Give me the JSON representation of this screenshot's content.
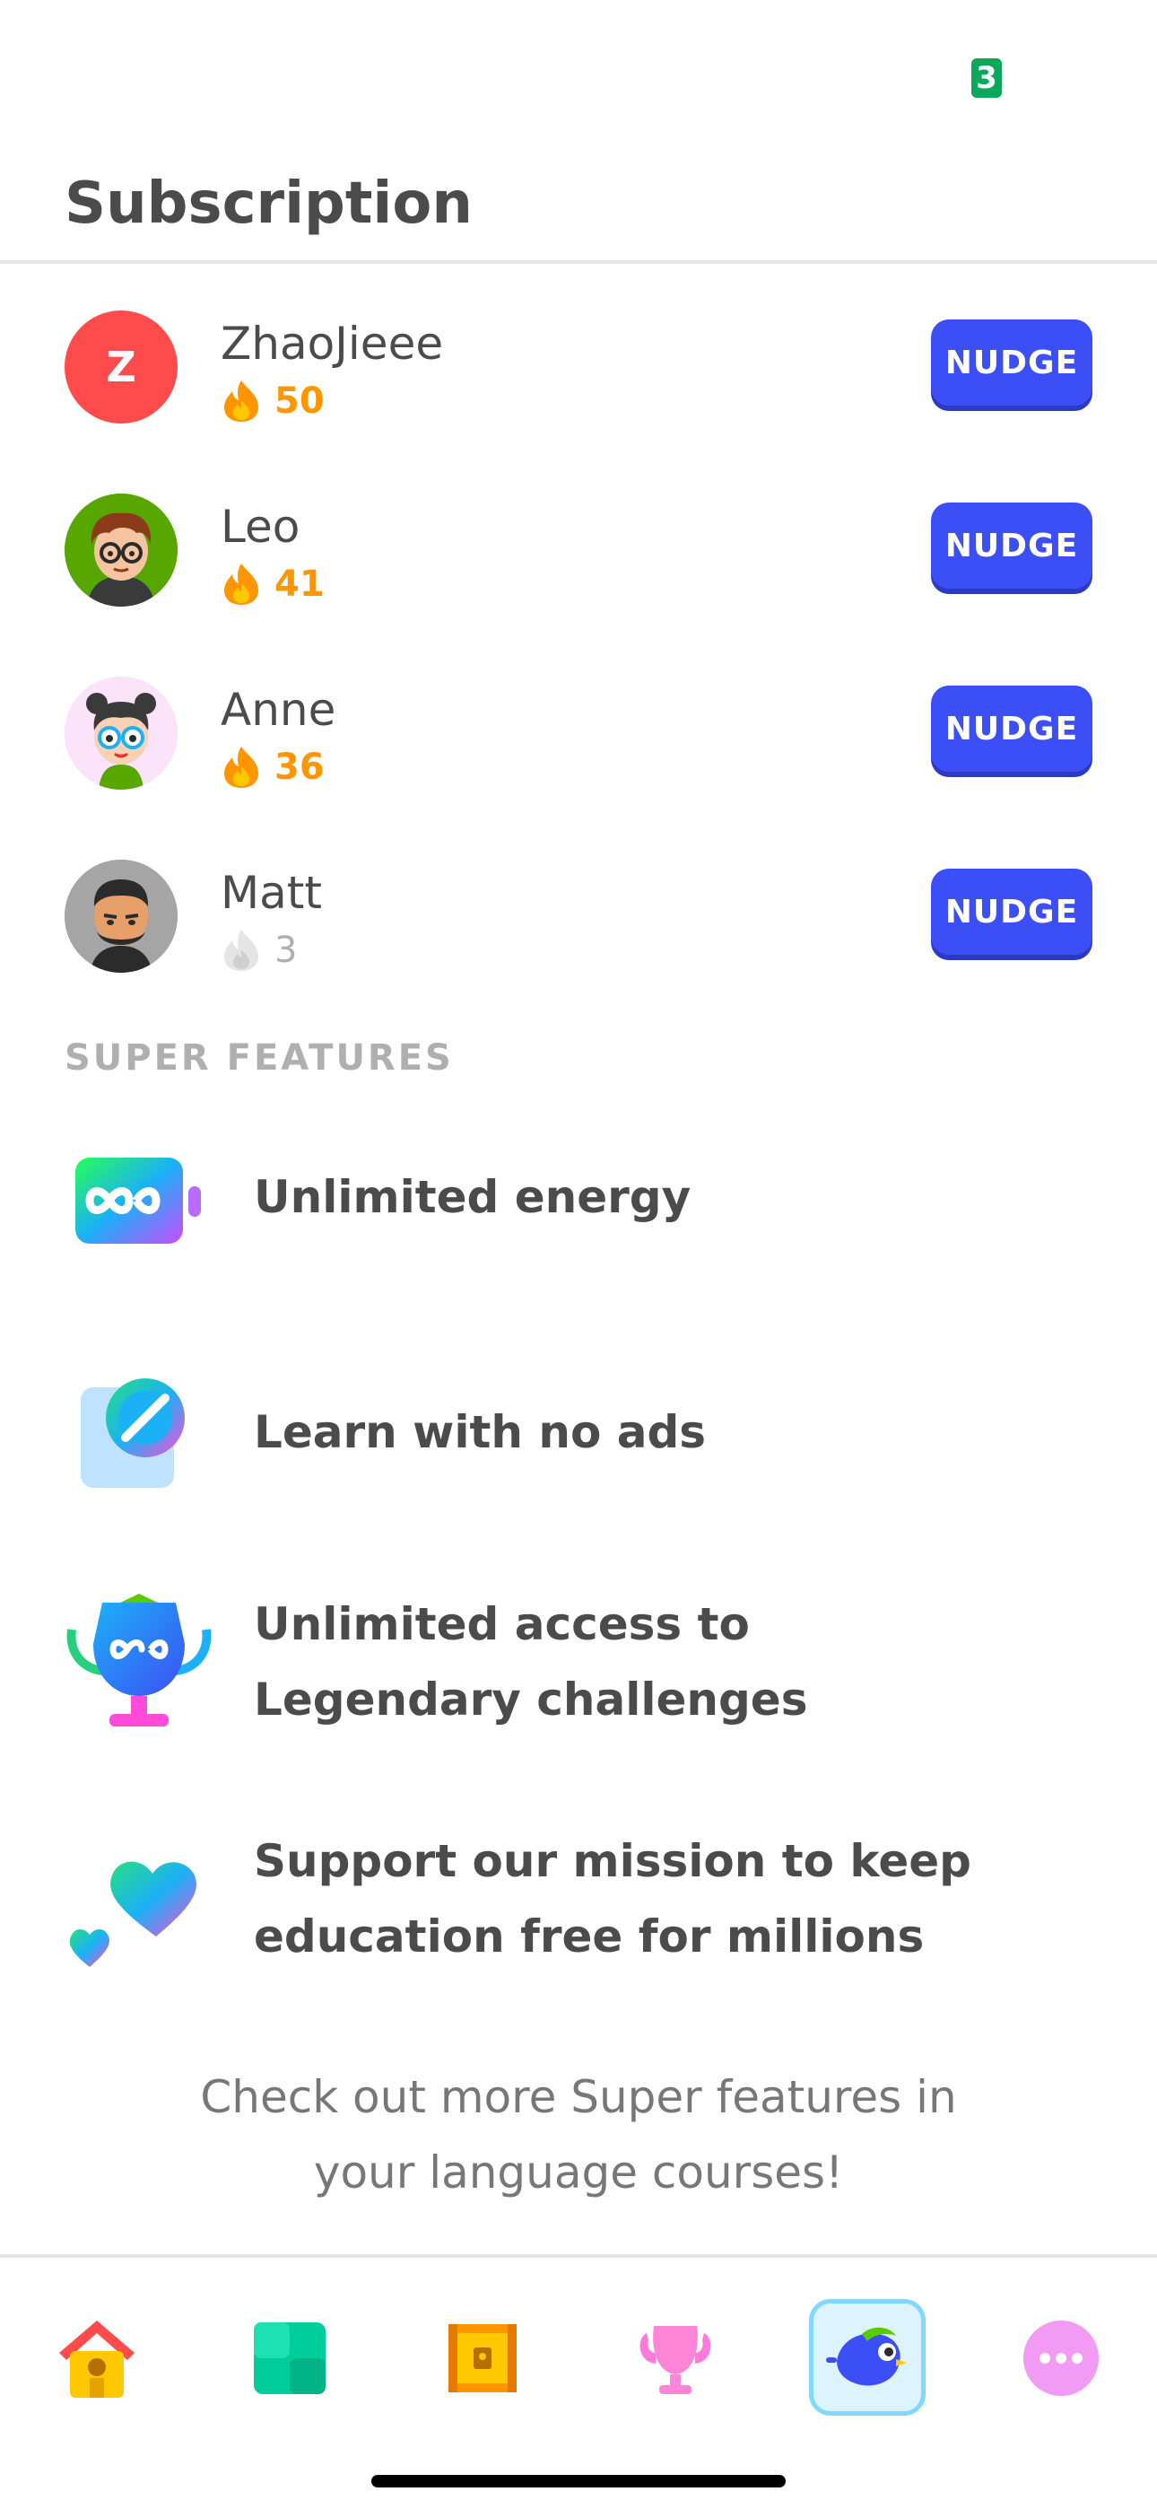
{
  "status": {
    "badge_text": "3"
  },
  "page": {
    "title": "Subscription"
  },
  "friends": [
    {
      "name": "ZhaoJieee",
      "streak": "50",
      "avatar_letter": "Z",
      "streak_active": true,
      "avatar_color": "#ff4b4b",
      "nudge_label": "NUDGE"
    },
    {
      "name": "Leo",
      "streak": "41",
      "streak_active": true,
      "avatar_color": "#58a700",
      "nudge_label": "NUDGE"
    },
    {
      "name": "Anne",
      "streak": "36",
      "streak_active": true,
      "avatar_color": "#f7d4f5",
      "nudge_label": "NUDGE"
    },
    {
      "name": "Matt",
      "streak": "3",
      "streak_active": false,
      "avatar_color": "#8a8a8a",
      "nudge_label": "NUDGE"
    }
  ],
  "super_features": {
    "label": "SUPER FEATURES",
    "items": [
      {
        "line1": "Unlimited energy",
        "line2": "",
        "icon": "infinity-energy-icon"
      },
      {
        "line1": "Learn with no ads",
        "line2": "",
        "icon": "no-ads-icon"
      },
      {
        "line1": "Unlimited access to",
        "line2": "Legendary challenges",
        "icon": "legendary-trophy-icon"
      },
      {
        "line1": "Support our mission to keep",
        "line2": "education free for millions",
        "icon": "hearts-icon"
      }
    ]
  },
  "footer": {
    "line1": "Check out more Super features in",
    "line2": "your language courses!"
  },
  "tabs": [
    {
      "id": "home",
      "icon": "home-icon",
      "active": false
    },
    {
      "id": "practice",
      "icon": "practice-icon",
      "active": false
    },
    {
      "id": "shop",
      "icon": "chest-icon",
      "active": false
    },
    {
      "id": "league",
      "icon": "trophy-icon",
      "active": false
    },
    {
      "id": "profile",
      "icon": "profile-bird-icon",
      "active": true
    },
    {
      "id": "more",
      "icon": "more-icon",
      "active": false
    }
  ],
  "colors": {
    "accent": "#3c4ef5",
    "streak": "#ff9600",
    "text": "#4b4b4b",
    "muted": "#afafaf"
  }
}
